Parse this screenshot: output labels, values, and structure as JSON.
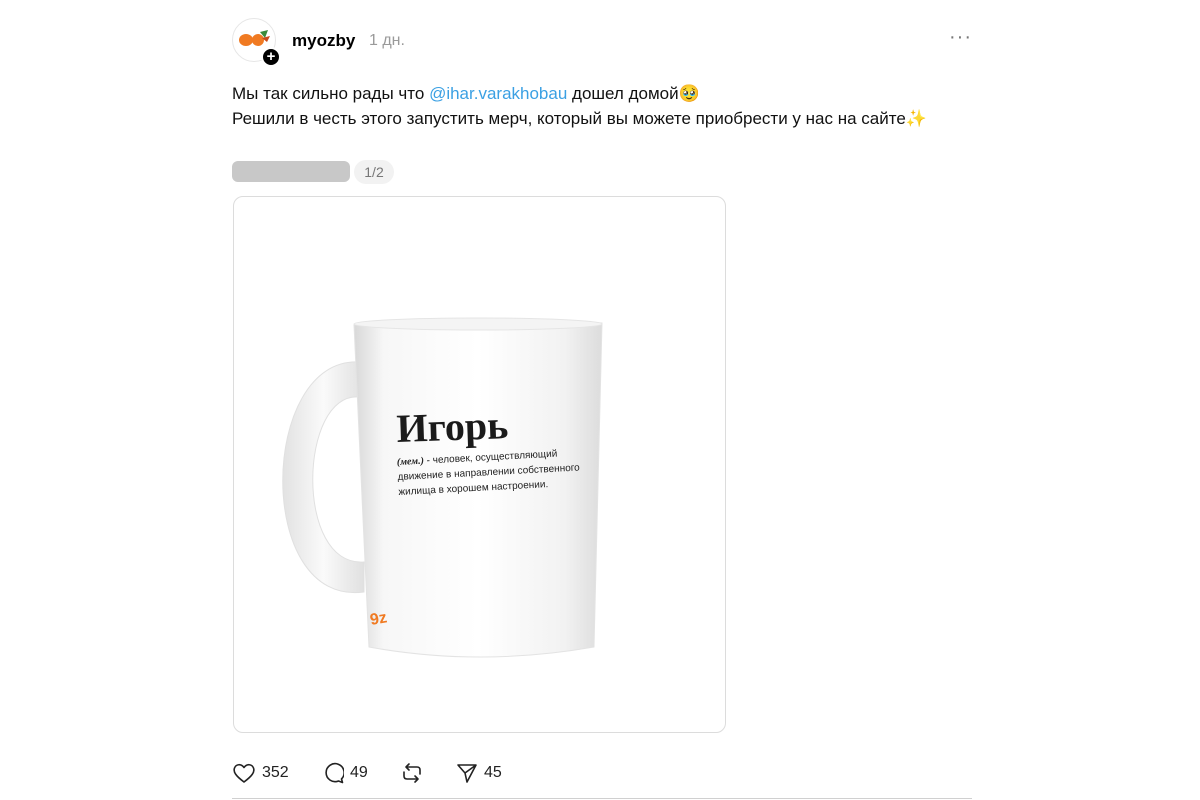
{
  "post": {
    "username": "myozby",
    "timestamp": "1 дн.",
    "more_label": "···",
    "text_line1_before": "Мы так сильно рады что ",
    "mention": "@ihar.varakhobau",
    "text_line1_after": " дошел домой🥹",
    "text_line2": "Решили в честь этого запустить мерч, который вы можете приобрести у нас на сайте✨",
    "image_counter": "1/2",
    "follow_badge": "+"
  },
  "mug": {
    "title": "Игорь",
    "definition_abbrev": "(мем.)",
    "definition_line1": " - человек, осуществляющий",
    "definition_line2": "движение в направлении собственного",
    "definition_line3": "жилища в хорошем настроении.",
    "logo": "9z"
  },
  "actions": {
    "likes": "352",
    "comments": "49",
    "shares": "45"
  },
  "colors": {
    "mention": "#3ba0e3",
    "brand_orange": "#f07a22"
  },
  "icons": [
    "heart-icon",
    "comment-icon",
    "repost-icon",
    "send-icon",
    "more-icon",
    "plus-icon"
  ]
}
